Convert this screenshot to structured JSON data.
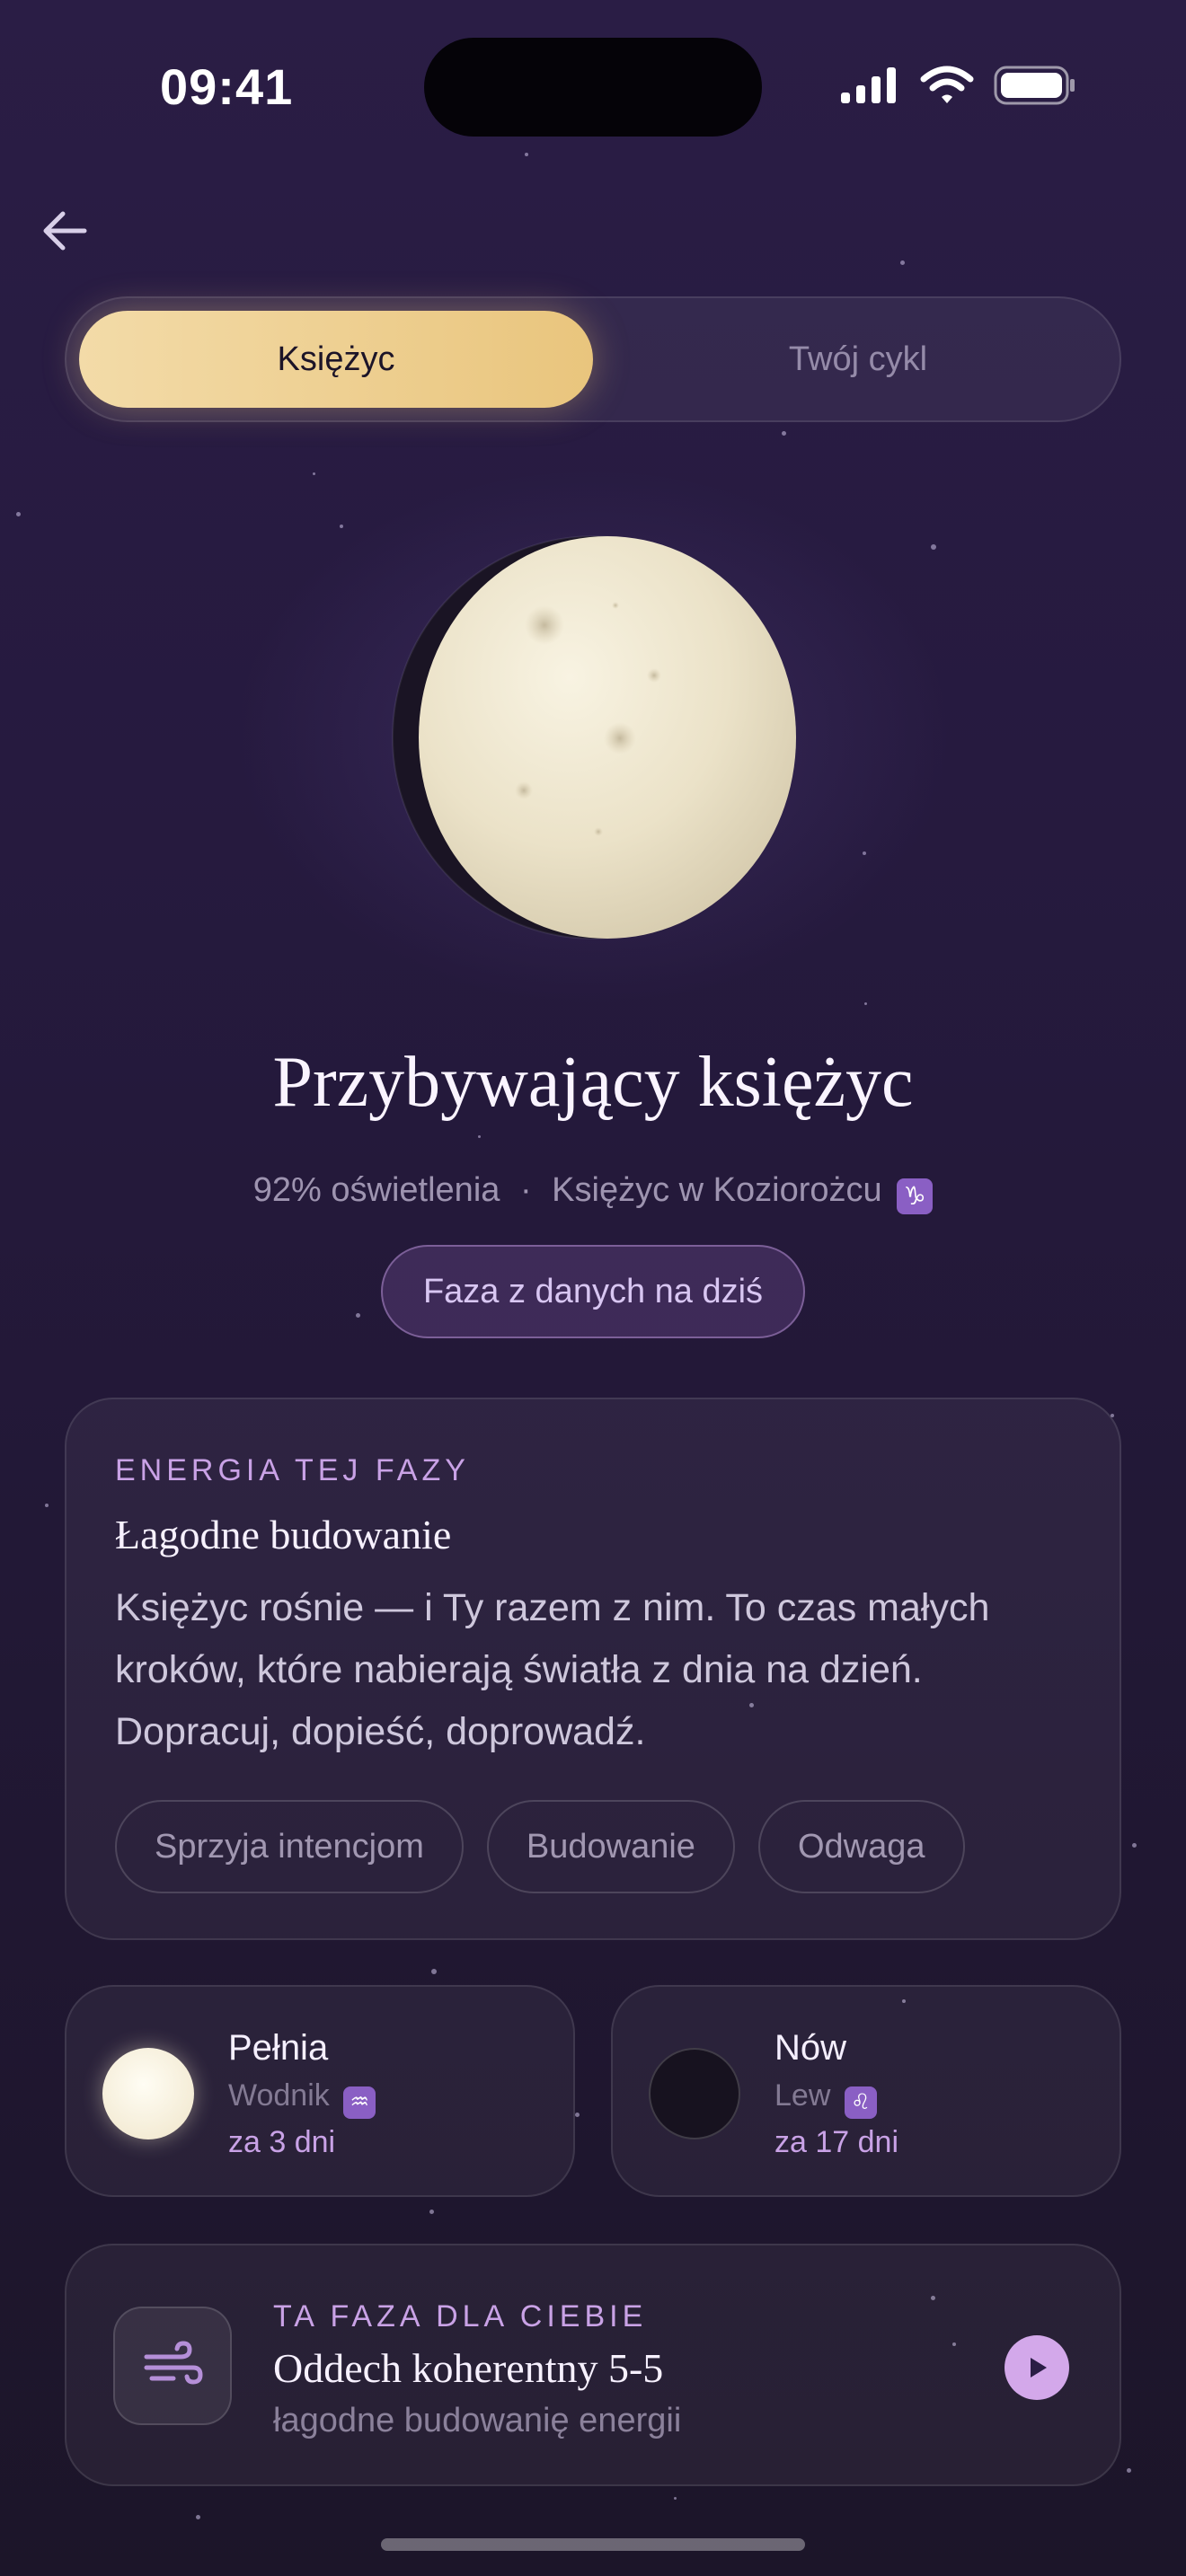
{
  "status_bar": {
    "time": "09:41"
  },
  "segments": {
    "active": "Księżyc",
    "inactive": "Twój cykl"
  },
  "moon": {
    "phase_name": "Przybywający księżyc",
    "illumination_text": "92% oświetlenia",
    "separator": "·",
    "sign_text": "Księżyc w Koziorożcu",
    "sign_symbol": "♑",
    "data_source_chip": "Faza z danych na dziś",
    "illumination_fraction": 0.92
  },
  "energy": {
    "eyebrow": "ENERGIA TEJ FAZY",
    "title": "Łagodne budowanie",
    "body": "Księżyc rośnie — i Ty razem z nim. To czas małych kroków, które nabierają światła z dnia na dzień. Dopracuj, dopieść, doprowadź.",
    "tags": [
      "Sprzyja intencjom",
      "Budowanie",
      "Odwaga"
    ]
  },
  "next_phases": [
    {
      "name": "Pełnia",
      "sign": "Wodnik",
      "sign_symbol": "♒",
      "when": "za 3 dni"
    },
    {
      "name": "Nów",
      "sign": "Lew",
      "sign_symbol": "♌",
      "when": "za 17 dni"
    }
  ],
  "practice": {
    "eyebrow": "TA FAZA DLA CIEBIE",
    "title": "Oddech koherentny 5-5",
    "subtitle": "łagodne budowanię energii",
    "icon": "wind-icon"
  },
  "colors": {
    "accent_gold": "#f3dba8",
    "accent_purple": "#c9a2e6",
    "play_button": "#d3a8ea",
    "background_top": "#2a1d45",
    "background_bottom": "#1c1529"
  }
}
